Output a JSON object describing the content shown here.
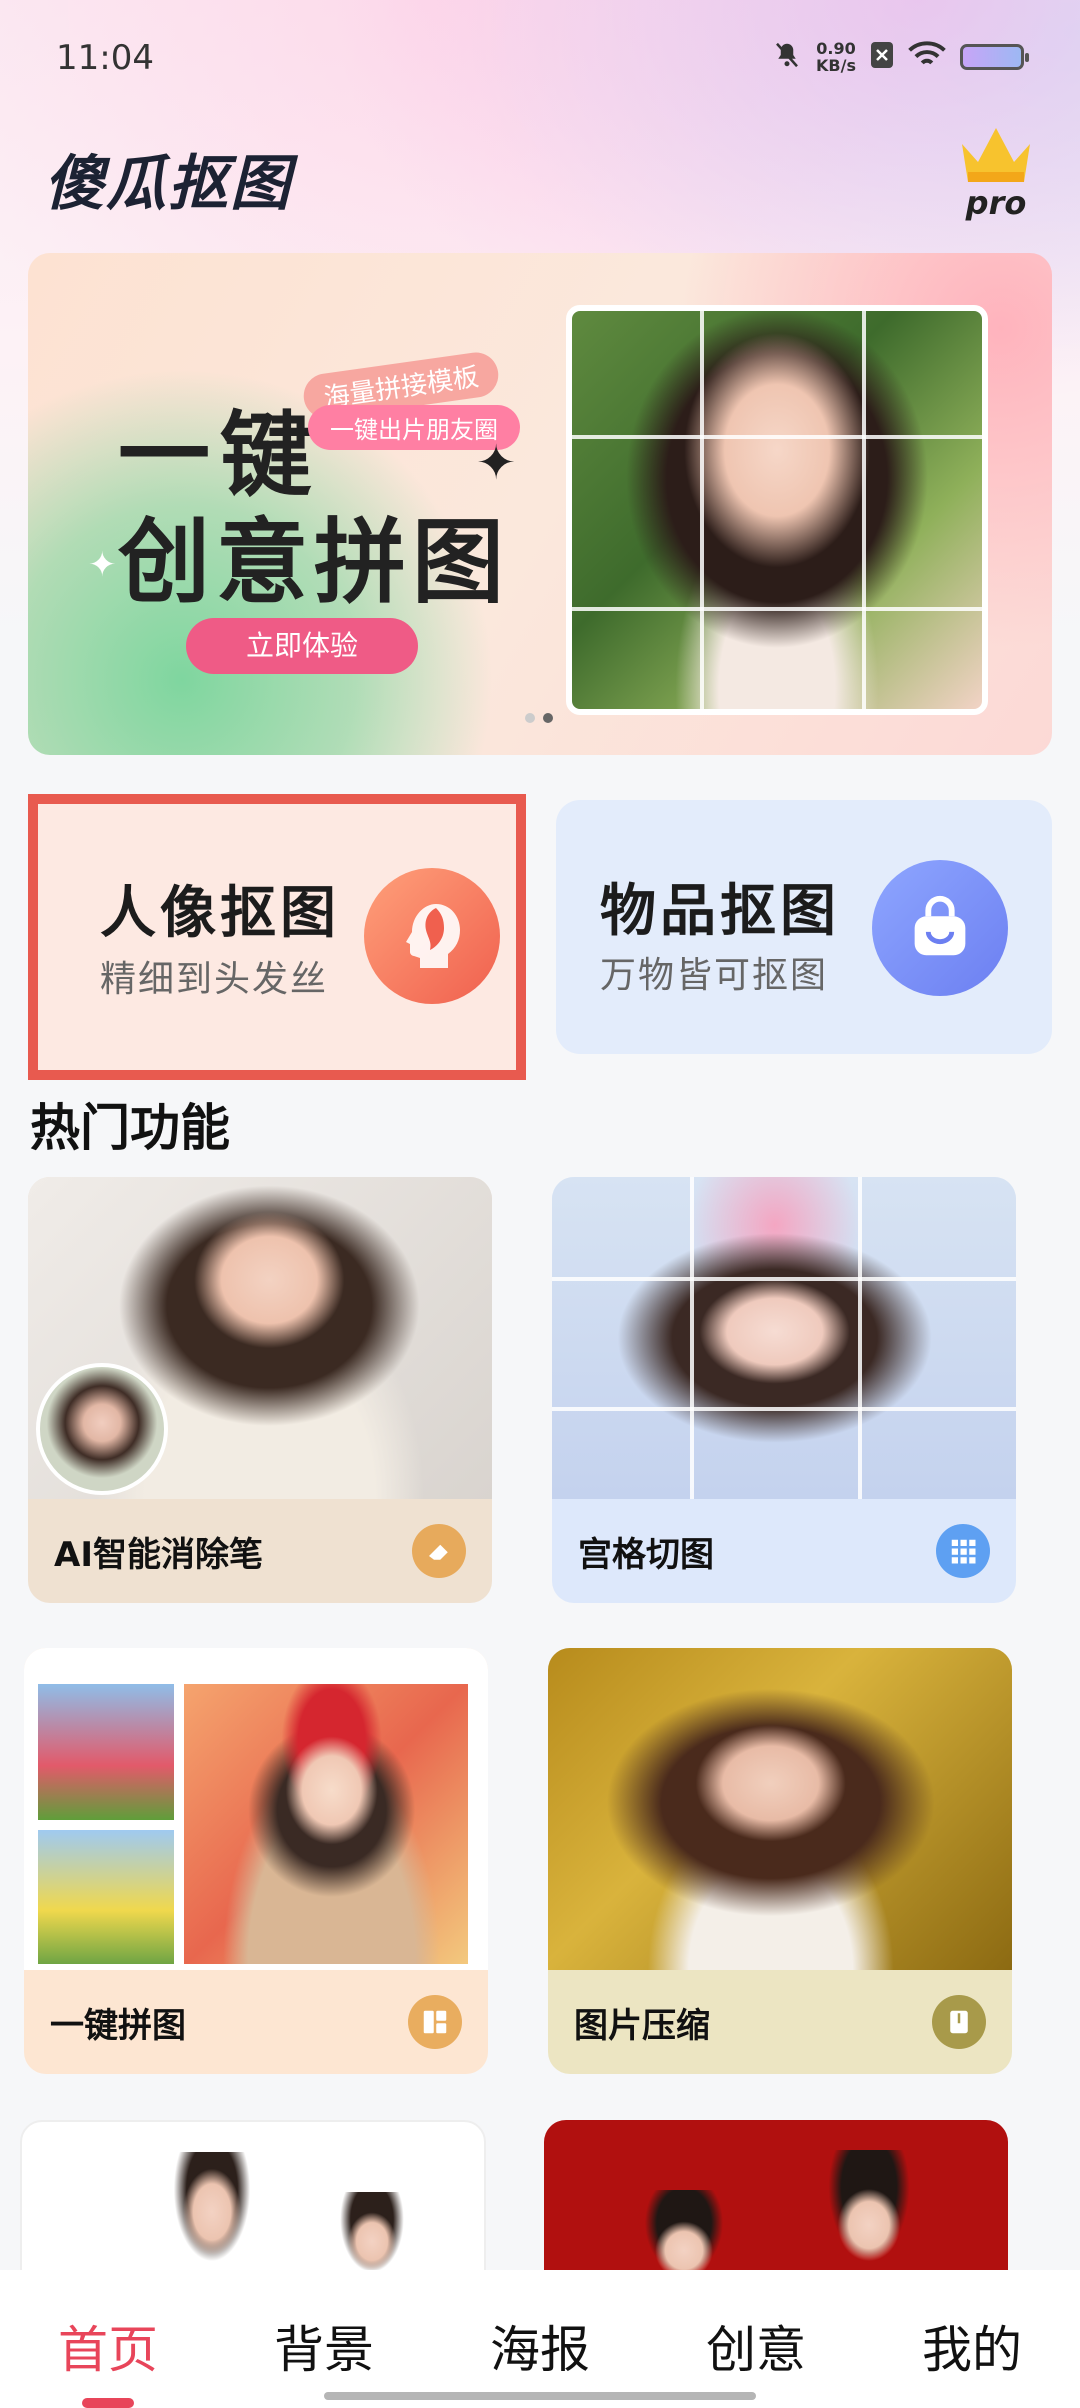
{
  "status_bar": {
    "time": "11:04",
    "speed_value": "0.90",
    "speed_unit": "KB/s"
  },
  "header": {
    "title": "傻瓜抠图",
    "pro_label": "pro"
  },
  "banner": {
    "line1": "一键",
    "line2": "创意拼图",
    "tag1": "海量拼接模板",
    "tag2": "一键出片朋友圈",
    "cta": "立即体验"
  },
  "features": [
    {
      "title": "人像抠图",
      "subtitle": "精细到头发丝"
    },
    {
      "title": "物品抠图",
      "subtitle": "万物皆可抠图"
    }
  ],
  "section_title": "热门功能",
  "tools": [
    {
      "label": "AI智能消除笔",
      "icon": "eraser-icon"
    },
    {
      "label": "宫格切图",
      "icon": "grid-icon"
    },
    {
      "label": "一键拼图",
      "icon": "collage-icon"
    },
    {
      "label": "图片压缩",
      "icon": "compress-icon"
    }
  ],
  "bottom_nav": [
    {
      "label": "首页",
      "active": true
    },
    {
      "label": "背景"
    },
    {
      "label": "海报"
    },
    {
      "label": "创意"
    },
    {
      "label": "我的"
    }
  ],
  "colors": {
    "accent": "#e8455a",
    "highlight_border": "#e85a4f",
    "cta": "#ef5b86"
  }
}
